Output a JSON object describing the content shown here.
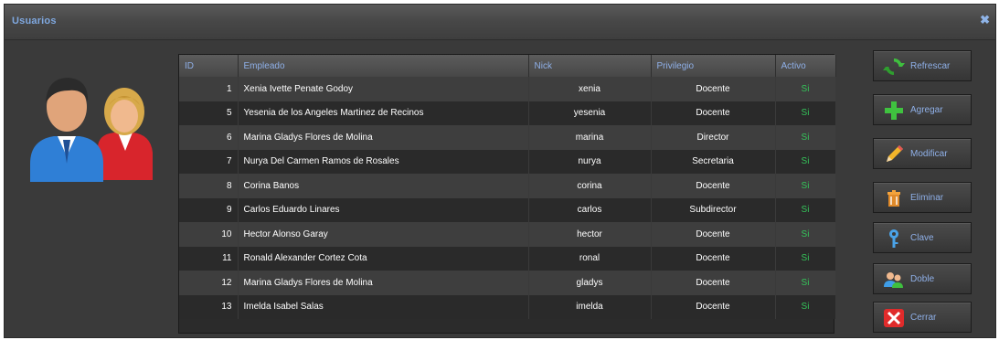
{
  "window": {
    "title": "Usuarios",
    "close_glyph": "✖"
  },
  "table": {
    "columns": [
      "ID",
      "Empleado",
      "Nick",
      "Privilegio",
      "Activo"
    ],
    "rows": [
      [
        "1",
        "Xenia Ivette Penate Godoy",
        "xenia",
        "Docente",
        "Si"
      ],
      [
        "5",
        "Yesenia de los Angeles Martinez de Recinos",
        "yesenia",
        "Docente",
        "Si"
      ],
      [
        "6",
        "Marina Gladys Flores de Molina",
        "marina",
        "Director",
        "Si"
      ],
      [
        "7",
        "Nurya Del Carmen Ramos de Rosales",
        "nurya",
        "Secretaria",
        "Si"
      ],
      [
        "8",
        "Corina Banos",
        "corina",
        "Docente",
        "Si"
      ],
      [
        "9",
        "Carlos Eduardo Linares",
        "carlos",
        "Subdirector",
        "Si"
      ],
      [
        "10",
        "Hector Alonso Garay",
        "hector",
        "Docente",
        "Si"
      ],
      [
        "11",
        "Ronald Alexander Cortez Cota",
        "ronal",
        "Docente",
        "Si"
      ],
      [
        "12",
        "Marina Gladys Flores de Molina",
        "gladys",
        "Docente",
        "Si"
      ],
      [
        "13",
        "Imelda Isabel Salas",
        "imelda",
        "Docente",
        "Si"
      ]
    ]
  },
  "buttons": {
    "refrescar": "Refrescar",
    "agregar": "Agregar",
    "modificar": "Modificar",
    "eliminar": "Eliminar",
    "clave": "Clave",
    "doble": "Doble",
    "cerrar": "Cerrar"
  },
  "colors": {
    "title_text": "#7fa8e0",
    "active_text": "#35c45a",
    "header_text": "#8fb0e8"
  }
}
